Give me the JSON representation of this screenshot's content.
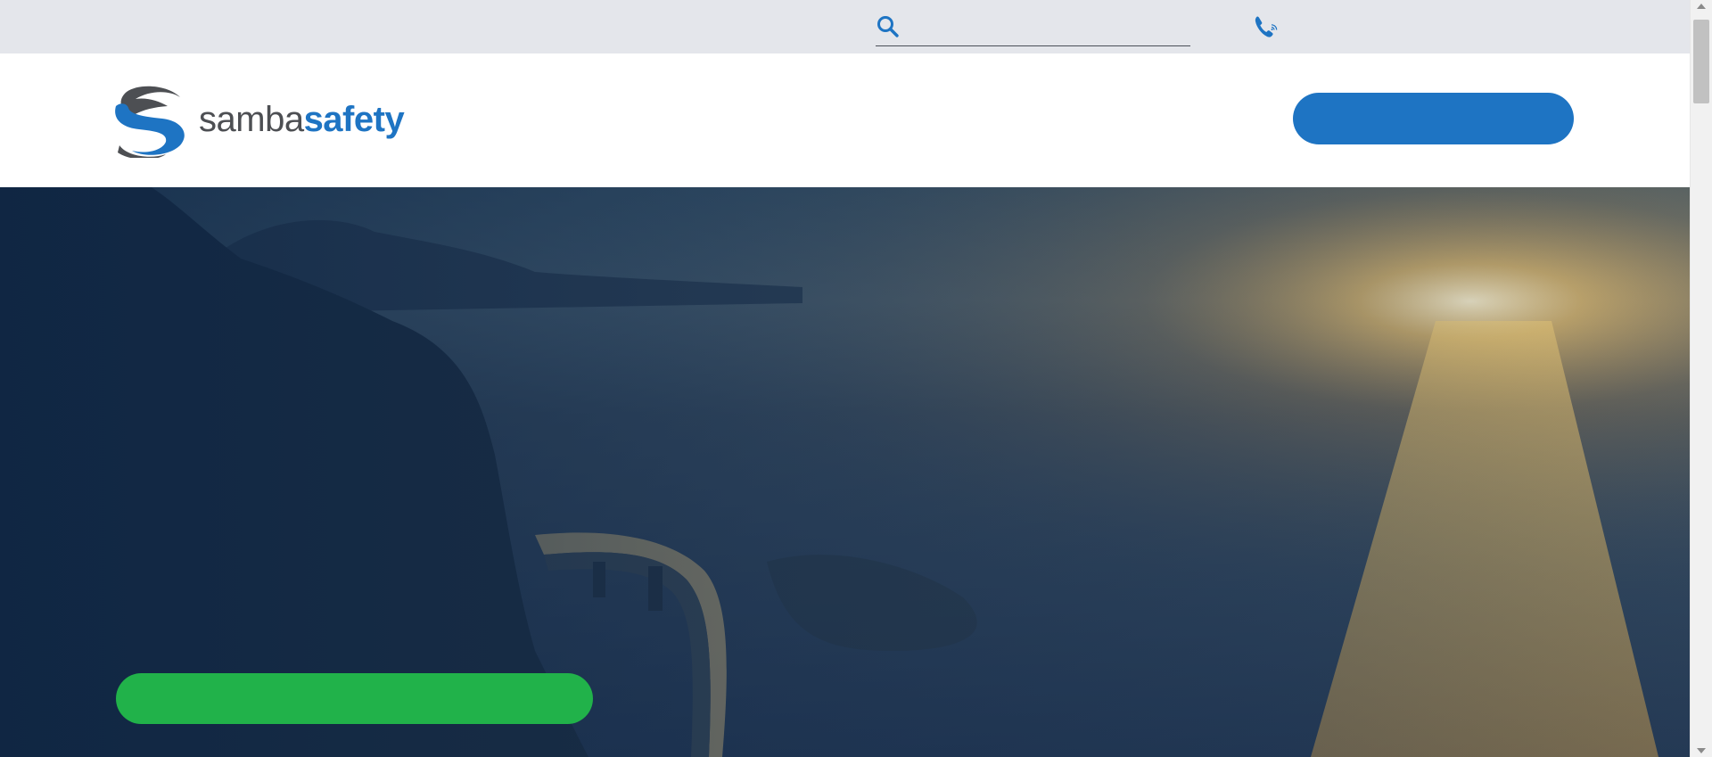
{
  "utility_bar": {
    "search": {
      "placeholder": "",
      "value": ""
    },
    "icons": {
      "search": "search-icon",
      "phone": "phone-icon"
    }
  },
  "header": {
    "logo": {
      "part1": "samba",
      "part2": "safety"
    },
    "cta_label": ""
  },
  "hero": {
    "cta_label": ""
  },
  "colors": {
    "brand_blue": "#1e74c3",
    "brand_gray": "#4d4f53",
    "cta_green": "#21b24a",
    "utility_bar_bg": "#e4e6eb",
    "hero_overlay": "#12294a"
  }
}
